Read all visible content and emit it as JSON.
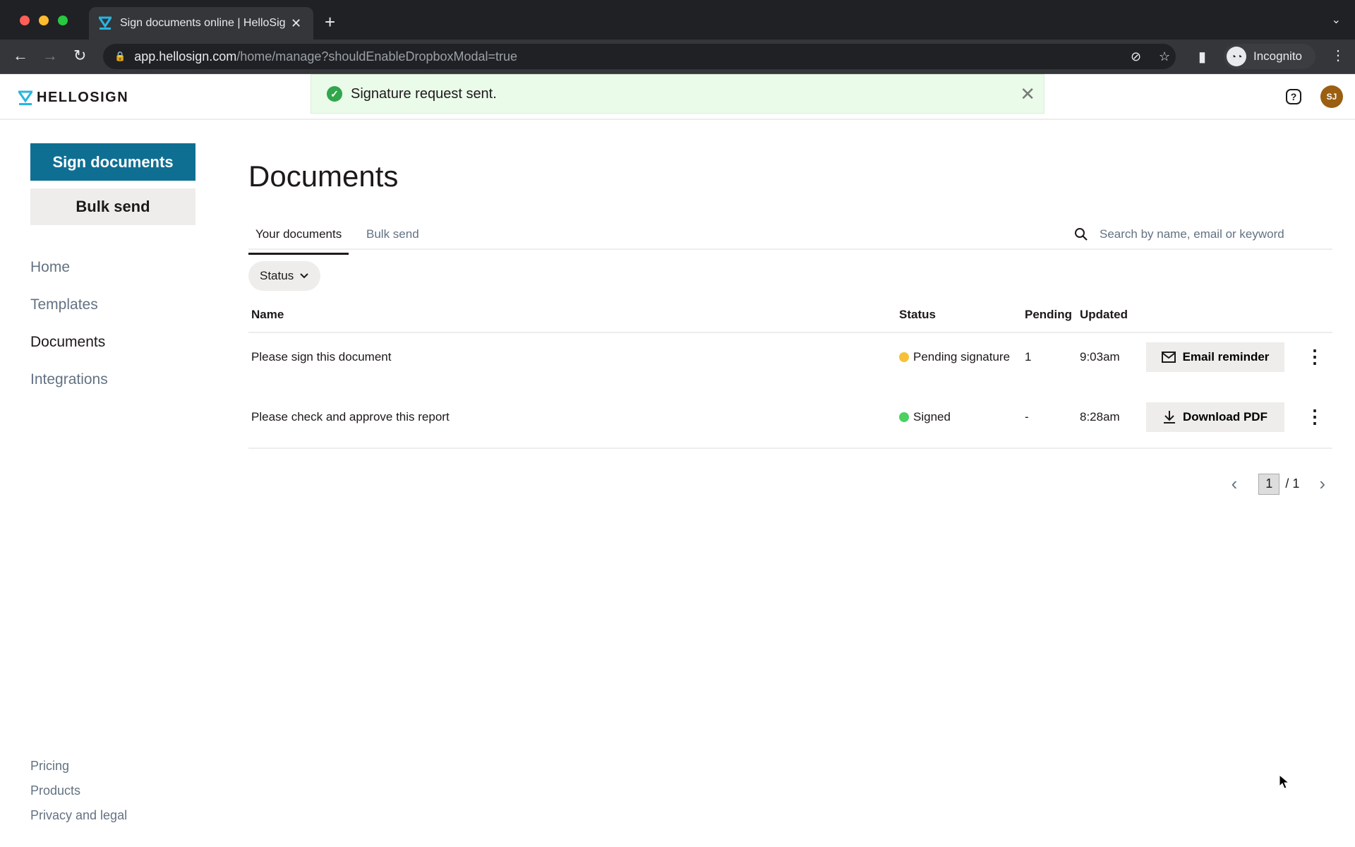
{
  "browser": {
    "tab_title": "Sign documents online | HelloSign",
    "url_host": "app.hellosign.com",
    "url_path": "/home/manage?shouldEnableDropboxModal=true",
    "incognito_label": "Incognito"
  },
  "header": {
    "logo_text": "HELLOSIGN",
    "toast_message": "Signature request sent.",
    "avatar_initials": "SJ",
    "help_glyph": "?"
  },
  "sidebar": {
    "primary_button": "Sign documents",
    "secondary_button": "Bulk send",
    "nav": [
      {
        "label": "Home",
        "active": false
      },
      {
        "label": "Templates",
        "active": false
      },
      {
        "label": "Documents",
        "active": true
      },
      {
        "label": "Integrations",
        "active": false
      }
    ],
    "footer": [
      {
        "label": "Pricing"
      },
      {
        "label": "Products"
      },
      {
        "label": "Privacy and legal"
      }
    ]
  },
  "main": {
    "title": "Documents",
    "tabs": [
      {
        "label": "Your documents",
        "active": true
      },
      {
        "label": "Bulk send",
        "active": false
      }
    ],
    "search_placeholder": "Search by name, email or keyword",
    "status_filter": "Status",
    "columns": {
      "name": "Name",
      "status": "Status",
      "pending": "Pending",
      "updated": "Updated"
    },
    "rows": [
      {
        "name": "Please sign this document",
        "status": "Pending signature",
        "status_color": "#f7c137",
        "pending": "1",
        "updated": "9:03am",
        "action": "Email reminder",
        "action_icon": "mail-icon"
      },
      {
        "name": "Please check and approve this report",
        "status": "Signed",
        "status_color": "#4bd160",
        "pending": "-",
        "updated": "8:28am",
        "action": "Download PDF",
        "action_icon": "download-icon"
      }
    ],
    "pagination": {
      "current": "1",
      "total": "/ 1"
    }
  },
  "colors": {
    "brand_primary": "#0f6f93",
    "toast_bg": "#eafbea",
    "avatar_bg": "#9b5f12"
  }
}
